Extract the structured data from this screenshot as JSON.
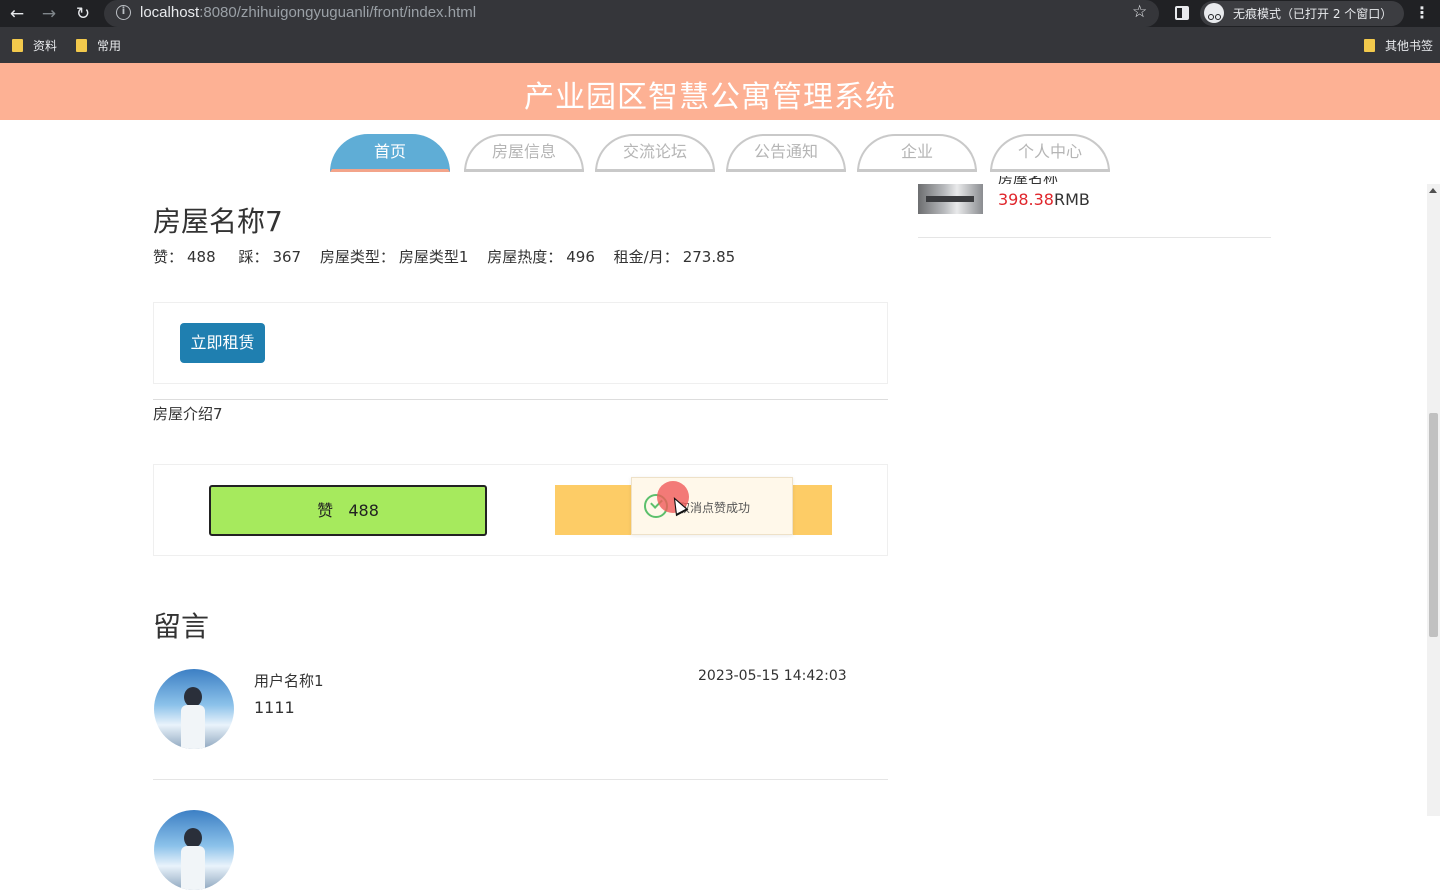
{
  "browser": {
    "url_host": "localhost",
    "url_rest": ":8080/zhihuigongyuguanli/front/index.html",
    "incognito_label": "无痕模式（已打开 2 个窗口）",
    "bookmarks": [
      "资料",
      "常用"
    ],
    "other_bookmarks": "其他书签"
  },
  "site": {
    "title": "产业园区智慧公寓管理系统"
  },
  "nav": {
    "tabs": [
      "首页",
      "房屋信息",
      "交流论坛",
      "公告通知",
      "企业",
      "个人中心"
    ],
    "active": "首页"
  },
  "house": {
    "title": "房屋名称7",
    "stats": {
      "like_label": "赞：",
      "like_value": "488",
      "dislike_label": "踩：",
      "dislike_value": "367",
      "type_label": "房屋类型：",
      "type_value": "房屋类型1",
      "heat_label": "房屋热度：",
      "heat_value": "496",
      "rent_label": "租金/月：",
      "rent_value": "273.85"
    },
    "rent_button": "立即租赁",
    "intro": "房屋介绍7",
    "like_button_label": "赞",
    "like_button_count": "488",
    "toast": "取消点赞成功"
  },
  "comments": {
    "title": "留言",
    "items": [
      {
        "user": "用户名称1",
        "text": "1111",
        "time": "2023-05-15 14:42:03"
      }
    ]
  },
  "sidebar": {
    "partial_name": "房屋名称",
    "price_value": "398.38",
    "price_unit": "RMB"
  }
}
